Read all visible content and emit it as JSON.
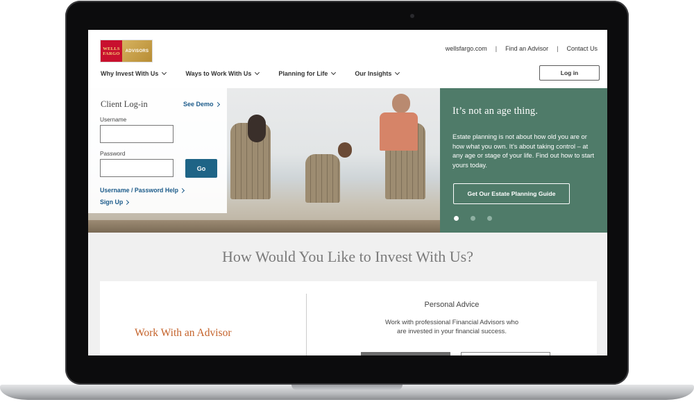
{
  "header": {
    "logo_line1": "WELLS",
    "logo_line2": "FARGO",
    "logo_adv": "ADVISORS",
    "utility": [
      "wellsfargo.com",
      "Find an Advisor",
      "Contact Us"
    ],
    "utility_sep": "|",
    "nav": [
      "Why Invest With Us",
      "Ways to Work With Us",
      "Planning for Life",
      "Our Insights"
    ],
    "login_label": "Log in"
  },
  "login": {
    "title": "Client Log-in",
    "see_demo": "See Demo",
    "username_label": "Username",
    "password_label": "Password",
    "go_label": "Go",
    "help_link": "Username / Password Help",
    "signup_link": "Sign Up"
  },
  "promo": {
    "title": "It’s not an age thing.",
    "text": "Estate planning is not about how old you are or how what you own. It’s about taking control – at any age or stage of your life. Find out how to start yours today.",
    "button": "Get Our Estate Planning Guide",
    "slides_count": 3,
    "active_slide": 1
  },
  "invest": {
    "title": "How Would You Like to Invest With Us?",
    "option_left": "Work With an Advisor",
    "personal_title": "Personal Advice",
    "personal_desc_line1": "Work with professional Financial Advisors who",
    "personal_desc_line2": "are invested in your financial success."
  },
  "colors": {
    "brand_red": "#c8102e",
    "promo_green": "#4f7b69",
    "go_blue": "#1e6486",
    "link_blue": "#1b5a8a",
    "accent_orange": "#c4622a"
  }
}
